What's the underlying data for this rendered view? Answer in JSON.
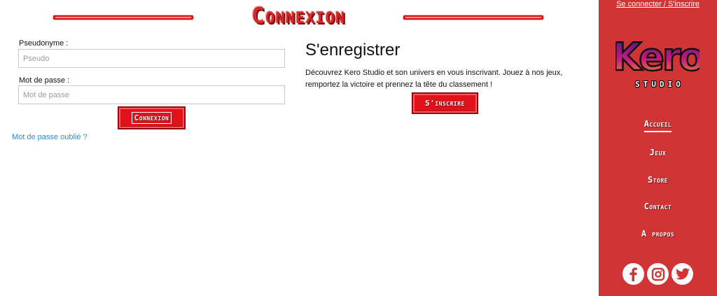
{
  "header": {
    "title": "Connexion"
  },
  "login": {
    "pseudo_label": "Pseudonyme :",
    "pseudo_placeholder": "Pseudo",
    "password_label": "Mot de passe :",
    "password_placeholder": "Mot de passe",
    "submit_label": "Connexion",
    "forgot_label": "Mot de passe oublié ?"
  },
  "register": {
    "title": "S'enregistrer",
    "text": "Découvrez Kero Studio et son univers en vous inscrivant. Jouez à nos jeux, remportez la victoire et prennez la tête du classement !",
    "button_label": "S'inscrire"
  },
  "sidebar": {
    "auth_link": "Se connecter / S'inscrire",
    "logo_name": "Kero",
    "logo_sub": "STUDIO",
    "nav": [
      {
        "label": "Accueil",
        "active": true
      },
      {
        "label": "Jeux",
        "active": false
      },
      {
        "label": "Store",
        "active": false
      },
      {
        "label": "Contact",
        "active": false
      },
      {
        "label": "A propos",
        "active": false
      }
    ],
    "social": [
      "facebook-icon",
      "instagram-icon",
      "twitter-icon"
    ]
  },
  "colors": {
    "accent_red": "#d03434",
    "button_red": "#e2121b",
    "link_blue": "#2a8fd6"
  }
}
